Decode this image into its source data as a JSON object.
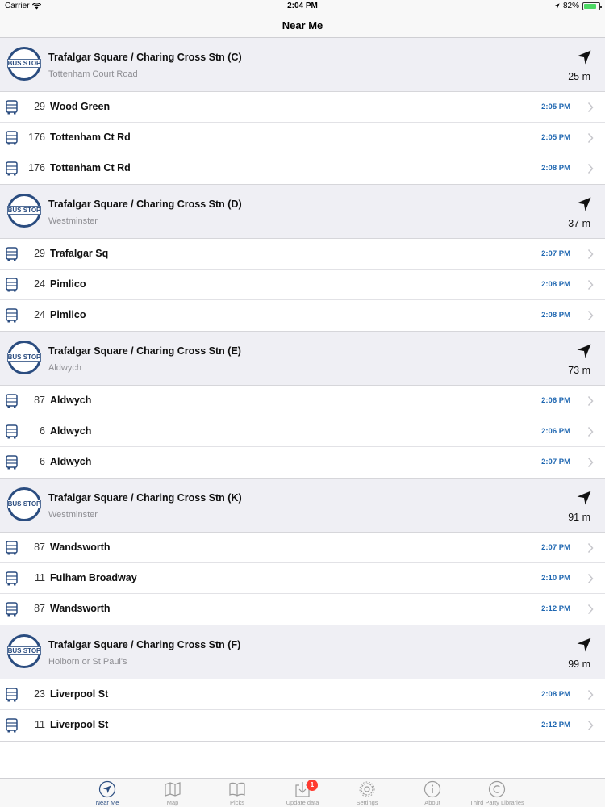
{
  "status_bar": {
    "carrier": "Carrier",
    "time": "2:04 PM",
    "battery": "82%",
    "battery_level": 0.82
  },
  "nav": {
    "title": "Near Me"
  },
  "icons": {
    "stop_logo": "bus-stop-roundel",
    "route": "bus-icon",
    "direction": "location-arrow",
    "row_accessory": "chevron-right"
  },
  "colors": {
    "accent": "#2b4d80",
    "time": "#1f67b1",
    "badge": "#ff3b30"
  },
  "stops": [
    {
      "logo_text": "BUS STOP",
      "name": "Trafalgar Square / Charing Cross Stn (C)",
      "towards": "Tottenham Court Road",
      "distance": "25 m",
      "routes": [
        {
          "number": "29",
          "destination": "Wood Green",
          "time": "2:05 PM"
        },
        {
          "number": "176",
          "destination": "Tottenham Ct Rd",
          "time": "2:05 PM"
        },
        {
          "number": "176",
          "destination": "Tottenham Ct Rd",
          "time": "2:08 PM"
        }
      ]
    },
    {
      "logo_text": "BUS STOP",
      "name": "Trafalgar Square / Charing Cross Stn (D)",
      "towards": "Westminster",
      "distance": "37 m",
      "routes": [
        {
          "number": "29",
          "destination": "Trafalgar Sq",
          "time": "2:07 PM"
        },
        {
          "number": "24",
          "destination": "Pimlico",
          "time": "2:08 PM"
        },
        {
          "number": "24",
          "destination": "Pimlico",
          "time": "2:08 PM"
        }
      ]
    },
    {
      "logo_text": "BUS STOP",
      "name": "Trafalgar Square / Charing Cross Stn (E)",
      "towards": "Aldwych",
      "distance": "73 m",
      "routes": [
        {
          "number": "87",
          "destination": "Aldwych",
          "time": "2:06 PM"
        },
        {
          "number": "6",
          "destination": "Aldwych",
          "time": "2:06 PM"
        },
        {
          "number": "6",
          "destination": "Aldwych",
          "time": "2:07 PM"
        }
      ]
    },
    {
      "logo_text": "BUS STOP",
      "name": "Trafalgar Square / Charing Cross Stn (K)",
      "towards": "Westminster",
      "distance": "91 m",
      "routes": [
        {
          "number": "87",
          "destination": "Wandsworth",
          "time": "2:07 PM"
        },
        {
          "number": "11",
          "destination": "Fulham Broadway",
          "time": "2:10 PM"
        },
        {
          "number": "87",
          "destination": "Wandsworth",
          "time": "2:12 PM"
        }
      ]
    },
    {
      "logo_text": "BUS STOP",
      "name": "Trafalgar Square / Charing Cross Stn (F)",
      "towards": "Holborn or St Paul's",
      "distance": "99 m",
      "routes": [
        {
          "number": "23",
          "destination": "Liverpool St",
          "time": "2:08 PM"
        },
        {
          "number": "11",
          "destination": "Liverpool St",
          "time": "2:12 PM"
        }
      ]
    }
  ],
  "tabs": [
    {
      "label": "Near Me",
      "icon": "location-arrow-icon",
      "active": true
    },
    {
      "label": "Map",
      "icon": "map-icon",
      "active": false
    },
    {
      "label": "Picks",
      "icon": "book-icon",
      "active": false
    },
    {
      "label": "Update data",
      "icon": "download-icon",
      "active": false,
      "badge": "1"
    },
    {
      "label": "Settings",
      "icon": "gear-icon",
      "active": false
    },
    {
      "label": "About",
      "icon": "info-icon",
      "active": false
    },
    {
      "label": "Third Party Libraries",
      "icon": "copyright-icon",
      "active": false
    }
  ]
}
